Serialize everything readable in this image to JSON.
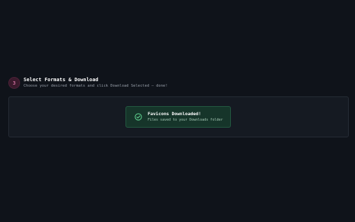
{
  "step": {
    "number": "3",
    "title": "Select Formats & Download",
    "description": "Choose your desired formats and click Download Selected — done!"
  },
  "toast": {
    "icon": "check-circle-icon",
    "title": "Favicons Downloaded!",
    "message": "Files saved to your Downloads folder"
  },
  "colors": {
    "background": "#0f131a",
    "panel": "#151a22",
    "success_bg": "#16352a",
    "success_accent": "#5fd18f",
    "step_badge": "#3a1a2c"
  }
}
